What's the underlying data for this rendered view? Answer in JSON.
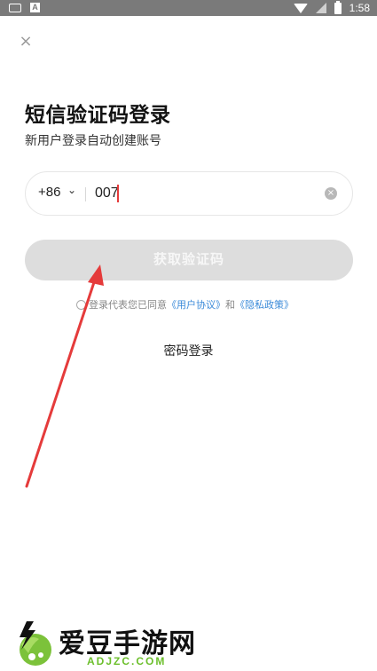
{
  "status_bar": {
    "time": "1:58",
    "left_icons": [
      "keyboard-icon",
      "a-app-icon"
    ],
    "right_icons": [
      "wifi-icon",
      "signal-icon",
      "battery-icon"
    ],
    "a_icon_label": "A"
  },
  "close_icon": "×",
  "title": "短信验证码登录",
  "subtitle": "新用户登录自动创建账号",
  "phone": {
    "country_code": "+86",
    "chevron": "⌄",
    "value": "007",
    "clear_icon": "×"
  },
  "get_code_button": "获取验证码",
  "agreement": {
    "prefix": "登录代表您已同意",
    "user_agreement": "《用户协议》",
    "and": "和",
    "privacy_policy": "《隐私政策》"
  },
  "password_login": "密码登录",
  "colors": {
    "arrow": "#e53b3b",
    "link": "#3b8bd9",
    "button_disabled": "#dddddd"
  },
  "watermark": {
    "title": "爱豆手游网",
    "url": "ADJZC.COM"
  }
}
